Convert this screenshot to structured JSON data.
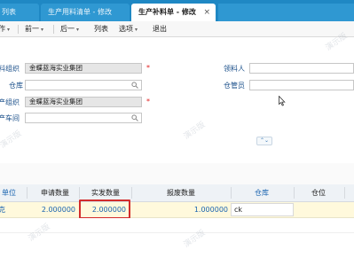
{
  "tabs": [
    {
      "label": "列表"
    },
    {
      "label": "生产用料清单 - 修改"
    },
    {
      "label": "生产补料单 - 修改",
      "close": "×"
    }
  ],
  "toolbar": {
    "items": [
      {
        "label": "作",
        "dropdown": "▾"
      },
      {
        "label": "前一",
        "dropdown": "▾"
      },
      {
        "label": "后一",
        "dropdown": "▾"
      },
      {
        "label": "列表"
      },
      {
        "label": "选项",
        "dropdown": "▾"
      },
      {
        "label": "退出"
      }
    ]
  },
  "form": {
    "material_org": {
      "label": "料组织",
      "value": "金蝶蓝海实业集团",
      "required": "*"
    },
    "warehouse": {
      "label": "仓库",
      "value": ""
    },
    "production_org": {
      "label": "产组织",
      "value": "金蝶蓝海实业集团",
      "required": "*"
    },
    "workshop": {
      "label": "产车间",
      "value": ""
    },
    "replenisher": {
      "label": "领料人",
      "value": ""
    },
    "keeper": {
      "label": "仓管员",
      "value": ""
    },
    "collapse_glyph": "⌃⌄"
  },
  "grid": {
    "columns": [
      {
        "label": "单位"
      },
      {
        "label": "申请数量"
      },
      {
        "label": "实发数量"
      },
      {
        "label": "报废数量"
      },
      {
        "label": "仓库"
      },
      {
        "label": "仓位"
      }
    ],
    "rows": [
      {
        "unit": "克",
        "requested": "2.000000",
        "actual": "2.000000",
        "scrap": "1.000000",
        "warehouse": "ck",
        "location": ""
      }
    ]
  },
  "watermark": "演示版",
  "colors": {
    "tabbar": "#1f88c4",
    "highlight": "#d22c2c",
    "row": "#fff9dc",
    "link": "#1a64b0"
  }
}
